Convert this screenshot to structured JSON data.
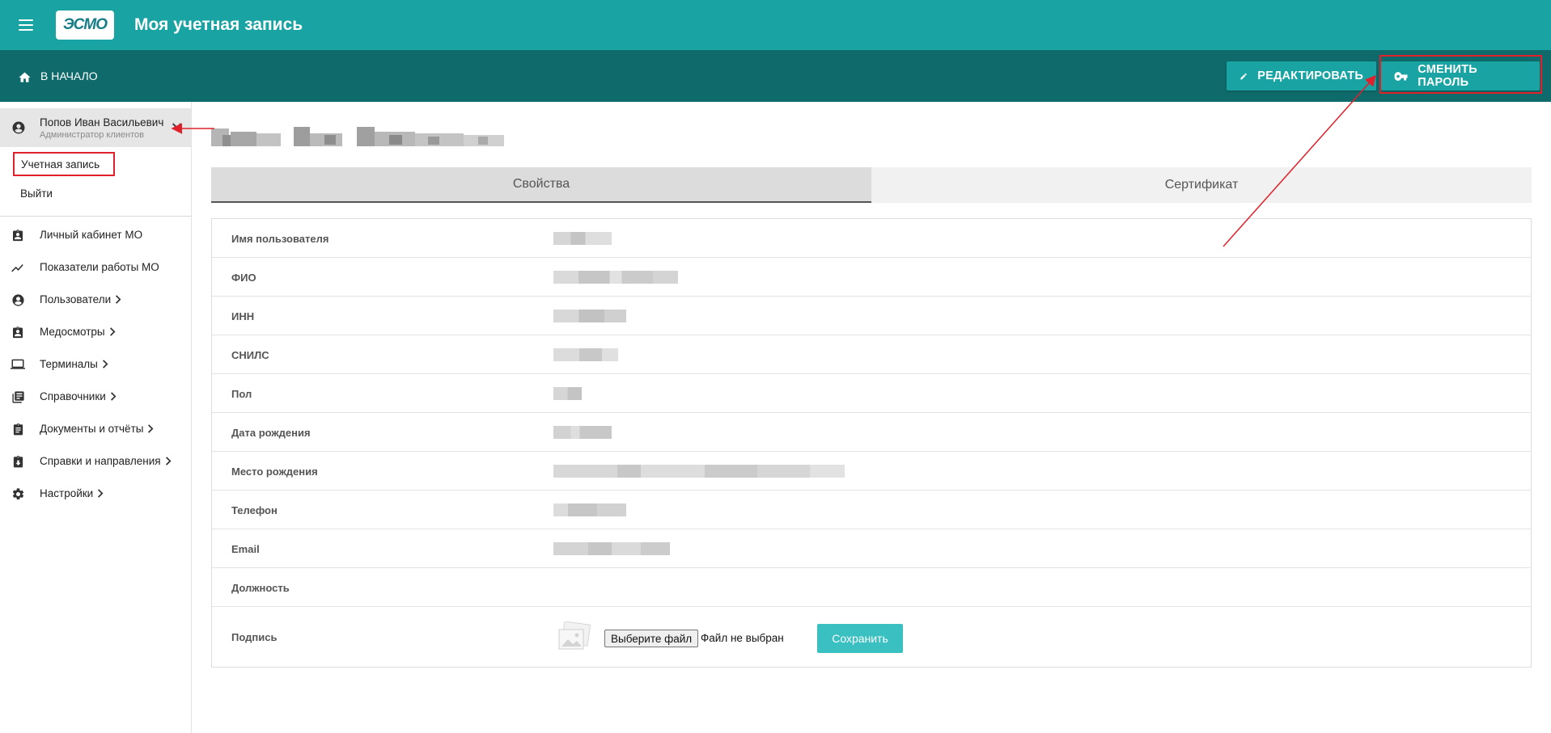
{
  "header": {
    "logo_text": "ЭСМО",
    "title": "Моя учетная запись"
  },
  "subbar": {
    "home_label": "В НАЧАЛО",
    "edit_label": "РЕДАКТИРОВАТЬ",
    "change_password_label": "СМЕНИТЬ ПАРОЛЬ"
  },
  "sidebar": {
    "user": {
      "name": "Попов Иван Васильевич",
      "role": "Администратор клиентов"
    },
    "account_link": "Учетная запись",
    "logout_link": "Выйти",
    "items": [
      {
        "label": "Личный кабинет МО",
        "icon": "badge-icon",
        "has_submenu": false
      },
      {
        "label": "Показатели работы МО",
        "icon": "trending-chart-icon",
        "has_submenu": false
      },
      {
        "label": "Пользователи",
        "icon": "account-circle-icon",
        "has_submenu": true
      },
      {
        "label": "Медосмотры",
        "icon": "medical-badge-icon",
        "has_submenu": true
      },
      {
        "label": "Терминалы",
        "icon": "laptop-icon",
        "has_submenu": true
      },
      {
        "label": "Справочники",
        "icon": "library-books-icon",
        "has_submenu": true
      },
      {
        "label": "Документы и отчёты",
        "icon": "clipboard-icon",
        "has_submenu": true
      },
      {
        "label": "Справки и направления",
        "icon": "clipboard-download-icon",
        "has_submenu": true
      },
      {
        "label": "Настройки",
        "icon": "gear-icon",
        "has_submenu": true
      }
    ]
  },
  "tabs": [
    {
      "label": "Свойства",
      "active": true
    },
    {
      "label": "Сертификат",
      "active": false
    }
  ],
  "properties": [
    {
      "label": "Имя пользователя",
      "value_blurred": true
    },
    {
      "label": "ФИО",
      "value_blurred": true
    },
    {
      "label": "ИНН",
      "value_blurred": true
    },
    {
      "label": "СНИЛС",
      "value_blurred": true
    },
    {
      "label": "Пол",
      "value_blurred": true
    },
    {
      "label": "Дата рождения",
      "value_blurred": true
    },
    {
      "label": "Место рождения",
      "value_blurred": true
    },
    {
      "label": "Телефон",
      "value_blurred": true
    },
    {
      "label": "Email",
      "value_blurred": true
    },
    {
      "label": "Должность",
      "value_blurred": false
    }
  ],
  "signature": {
    "label": "Подпись",
    "file_button": "Выберите файл",
    "no_file_text": "Файл не выбран",
    "save_label": "Сохранить"
  },
  "colors": {
    "topbar": "#1aa3a3",
    "subbar": "#0f6b6b",
    "accent_button": "#3ac0c0",
    "annotation_red": "#e0202a"
  }
}
